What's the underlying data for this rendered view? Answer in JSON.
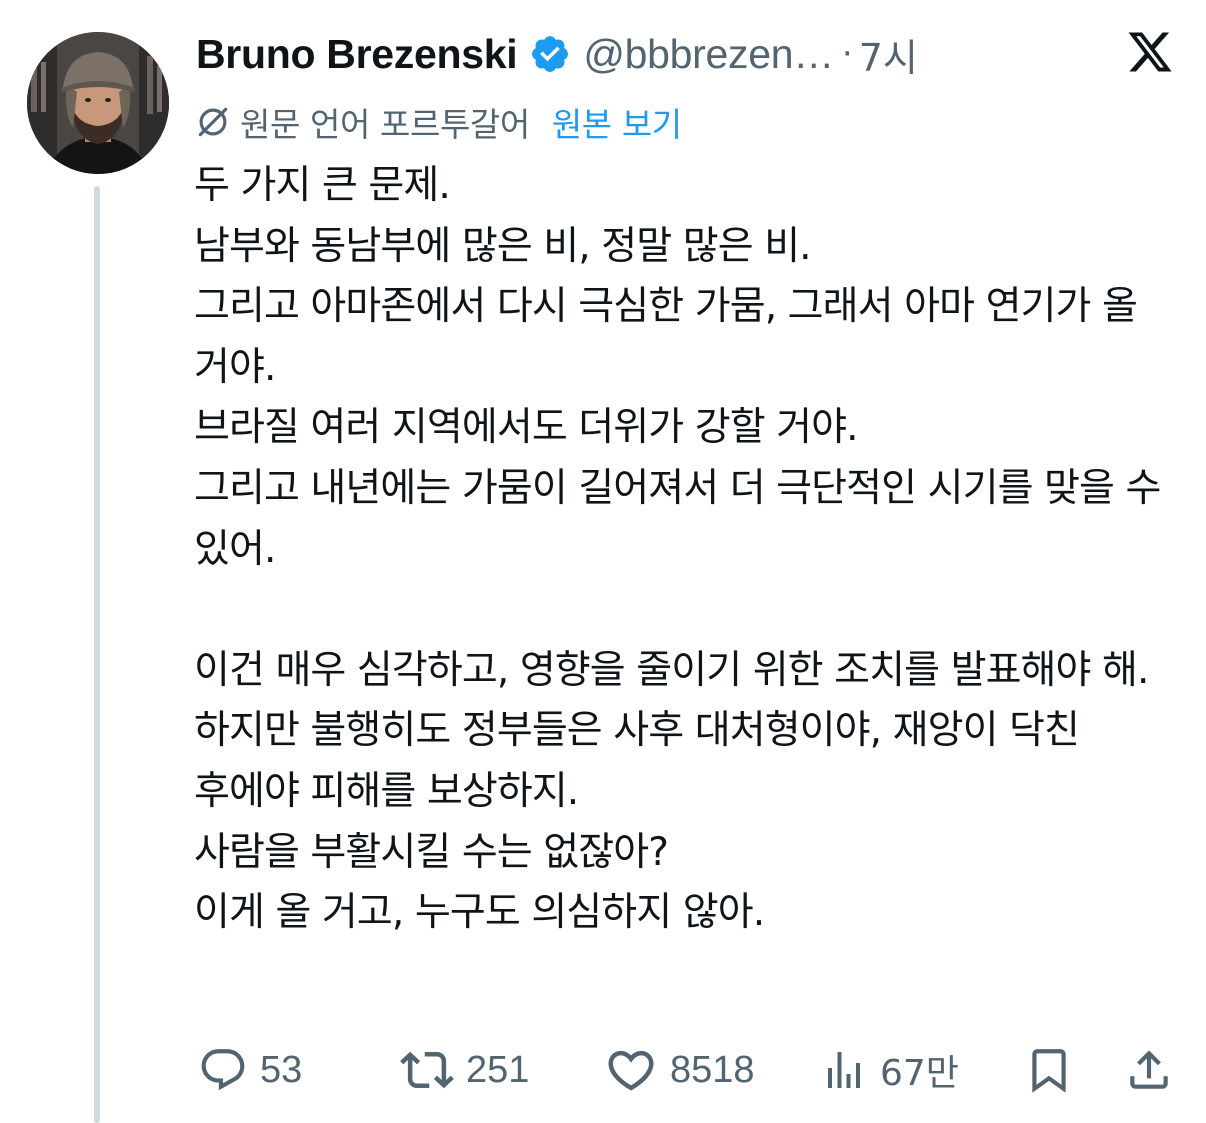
{
  "author": {
    "display_name": "Bruno Brezenski",
    "handle": "@bbbrezen…",
    "separator": "·",
    "time": "7시"
  },
  "translation": {
    "label": "원문 언어 포르투갈어",
    "show_original": "원본 보기"
  },
  "tweet": {
    "lines": [
      "두 가지 큰 문제.",
      "남부와 동남부에 많은 비, 정말 많은 비.",
      "그리고 아마존에서 다시 극심한 가뭄, 그래서 아마 연기가 올 거야.",
      "브라질 여러 지역에서도 더위가 강할 거야.",
      "그리고 내년에는 가뭄이 길어져서 더 극단적인 시기를 맞을 수 있어.",
      "",
      "이건 매우 심각하고, 영향을 줄이기 위한 조치를 발표해야 해.",
      "하지만 불행히도 정부들은 사후 대처형이야, 재앙이 닥친 후에야 피해를 보상하지.",
      "사람을 부활시킬 수는 없잖아?",
      "이게 올 거고, 누구도 의심하지 않아."
    ]
  },
  "actions": {
    "replies": "53",
    "reposts": "251",
    "likes": "8518",
    "views": "67만"
  },
  "icons": {
    "verified": "verified-badge-icon",
    "brand": "x-logo-icon",
    "translate": "translate-icon",
    "reply": "reply-icon",
    "repost": "repost-icon",
    "like": "heart-icon",
    "views": "views-icon",
    "bookmark": "bookmark-icon",
    "share": "share-icon"
  },
  "colors": {
    "text": "#0f1419",
    "secondary": "#536471",
    "link": "#1d9bf0",
    "verified": "#1d9bf0",
    "thread_line": "#cfd9de"
  }
}
